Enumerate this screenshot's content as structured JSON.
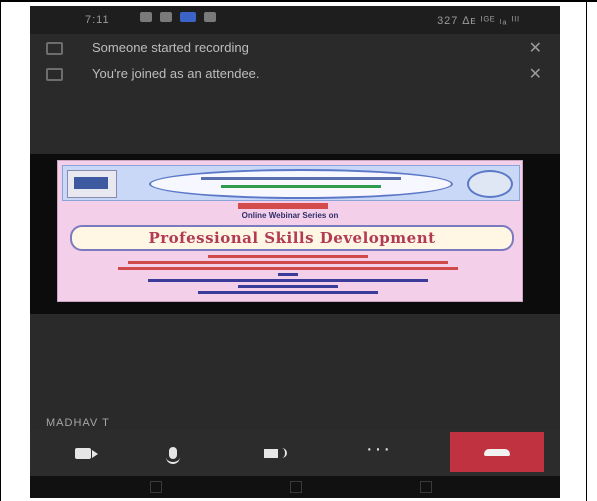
{
  "status_bar": {
    "time": "7:11",
    "right_text": "327 ∆ᴇ ᴵᴳᴱ ₗₐ ᴵᴵᴵ"
  },
  "notifications": [
    {
      "text": "Someone started recording",
      "icon": "record-icon",
      "close_icon": "close-icon"
    },
    {
      "text": "You're joined as an attendee.",
      "icon": "info-icon",
      "close_icon": "close-icon"
    }
  ],
  "slide": {
    "series_line": "Online Webinar Series on",
    "title": "Professional Skills Development"
  },
  "speaker_name": "MADHAV T",
  "toolbar": {
    "camera_icon": "camera-icon",
    "mic_icon": "microphone-icon",
    "speaker_icon": "speaker-icon",
    "more_icon": "more-options-icon",
    "more_label": "···",
    "end_icon": "hang-up-icon"
  },
  "colors": {
    "end_call": "#c0323f",
    "background": "#2a2a2a",
    "slide_bg": "#f4cfe9",
    "slide_title": "#b13a55"
  }
}
